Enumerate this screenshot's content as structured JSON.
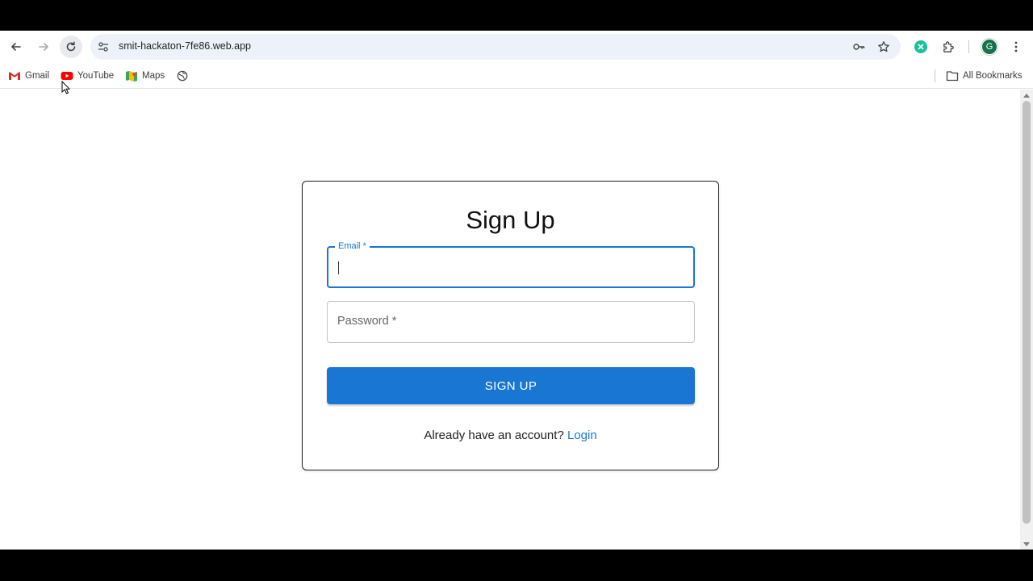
{
  "browser": {
    "url": "smit-hackaton-7fe86.web.app",
    "avatar_letter": "G",
    "bookmarks": [
      {
        "label": "Gmail",
        "icon": "gmail-icon"
      },
      {
        "label": "YouTube",
        "icon": "youtube-icon"
      },
      {
        "label": "Maps",
        "icon": "maps-icon"
      },
      {
        "label": "",
        "icon": "globe-icon"
      }
    ],
    "all_bookmarks_label": "All Bookmarks"
  },
  "form": {
    "title": "Sign Up",
    "email_label": "Email *",
    "email_value": "",
    "password_label": "Password *",
    "submit_label": "SIGN UP",
    "footer_prompt": "Already have an account?",
    "login_link": "Login"
  },
  "colors": {
    "accent": "#1976d2",
    "omnibox_bg": "#edf2fa",
    "avatar_bg": "#16724a"
  }
}
